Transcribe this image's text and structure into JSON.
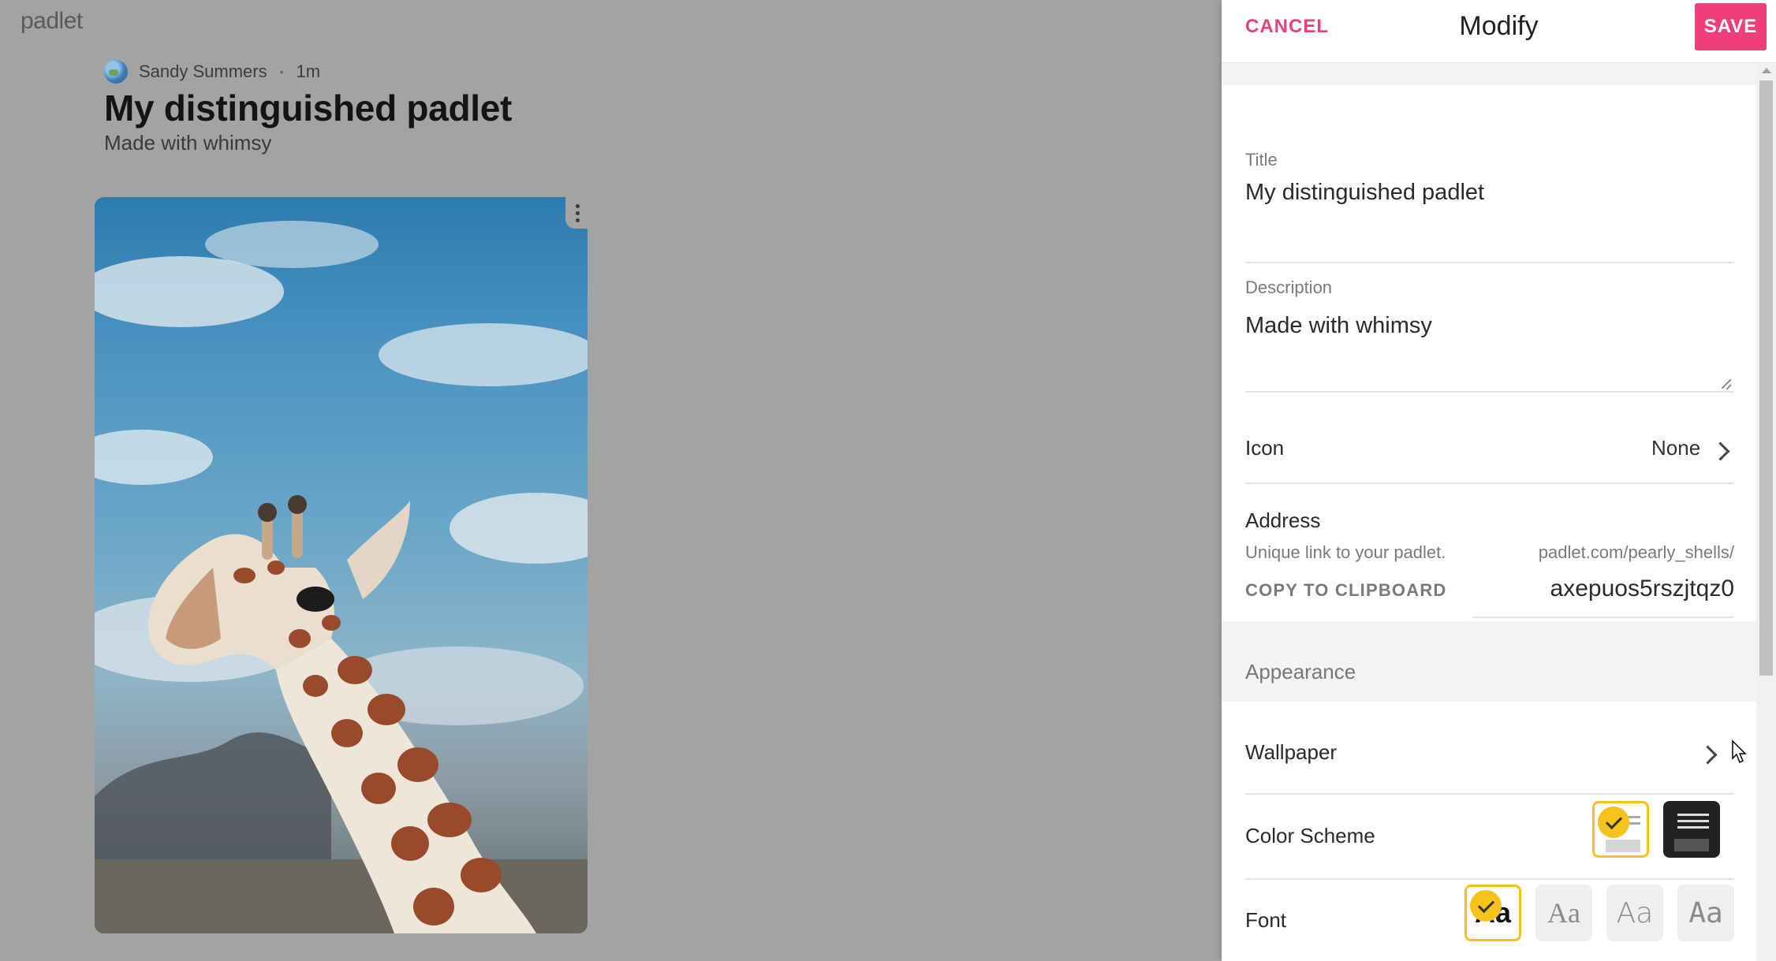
{
  "board": {
    "logo": "padlet",
    "author": "Sandy Summers",
    "separator": "•",
    "time": "1m",
    "title": "My distinguished padlet",
    "subtitle": "Made with whimsy"
  },
  "panel": {
    "cancel_label": "CANCEL",
    "title": "Modify",
    "save_label": "SAVE",
    "title_field": {
      "label": "Title",
      "value": "My distinguished padlet"
    },
    "description_field": {
      "label": "Description",
      "value": "Made with whimsy"
    },
    "icon_row": {
      "label": "Icon",
      "value": "None"
    },
    "address": {
      "label": "Address",
      "hint": "Unique link to your padlet.",
      "prefix": "padlet.com/pearly_shells/",
      "copy_label": "COPY TO CLIPBOARD",
      "slug": "axepuos5rszjtqz0"
    },
    "appearance_heading": "Appearance",
    "wallpaper_label": "Wallpaper",
    "color_scheme_label": "Color Scheme",
    "font_label": "Font",
    "font_options": [
      "Aa",
      "Aa",
      "Aa",
      "Aa"
    ]
  },
  "colors": {
    "accent": "#ee3f7c",
    "selected": "#f7c21b"
  }
}
